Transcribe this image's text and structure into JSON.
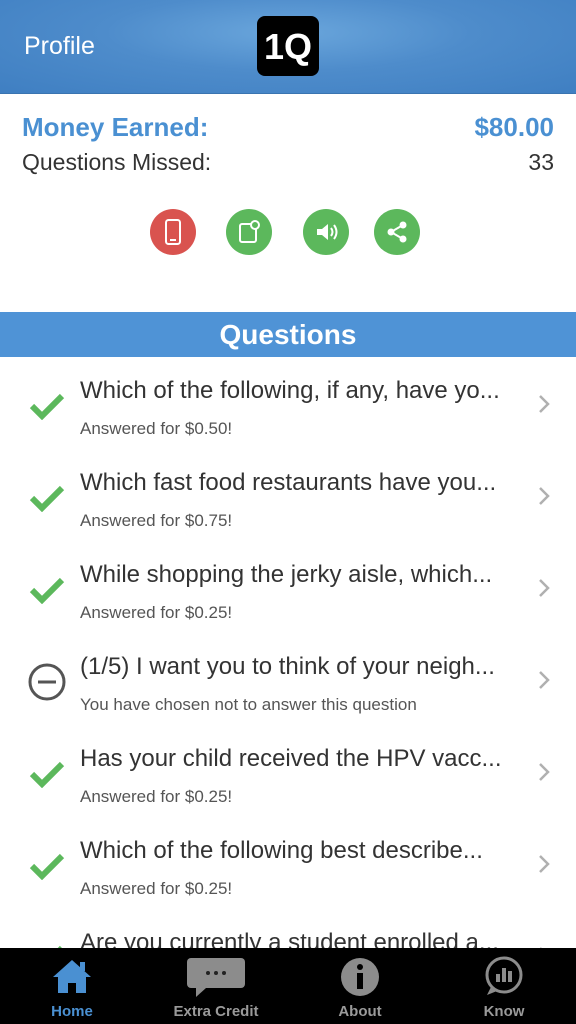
{
  "header": {
    "back_label": "Profile",
    "logo_text": "1Q"
  },
  "stats": {
    "money_label": "Money Earned:",
    "money_value": "$80.00",
    "missed_label": "Questions Missed:",
    "missed_value": "33"
  },
  "actions": [
    {
      "icon": "phone-icon",
      "color": "#d9534f"
    },
    {
      "icon": "tablet-notification-icon",
      "color": "#5cb85c"
    },
    {
      "icon": "speaker-icon",
      "color": "#5cb85c"
    },
    {
      "icon": "share-icon",
      "color": "#5cb85c"
    }
  ],
  "section": {
    "title": "Questions"
  },
  "questions": [
    {
      "title": "Which of the following, if any, have yo...",
      "subtitle": "Answered for $0.50!",
      "status": "answered"
    },
    {
      "title": "Which fast food restaurants have you...",
      "subtitle": "Answered for $0.75!",
      "status": "answered"
    },
    {
      "title": "While shopping the jerky aisle, which...",
      "subtitle": "Answered for $0.25!",
      "status": "answered"
    },
    {
      "title": "(1/5) I want you to think of your neigh...",
      "subtitle": "You have chosen not to answer this question",
      "status": "declined"
    },
    {
      "title": "Has your child received the HPV vacc...",
      "subtitle": "Answered for $0.25!",
      "status": "answered"
    },
    {
      "title": "Which of the following best describe...",
      "subtitle": "Answered for $0.25!",
      "status": "answered"
    },
    {
      "title": "Are you currently a student enrolled a...",
      "subtitle": "",
      "status": "answered"
    }
  ],
  "tabs": [
    {
      "label": "Home",
      "icon": "home-icon",
      "active": true
    },
    {
      "label": "Extra Credit",
      "icon": "chat-bubble-icon",
      "active": false
    },
    {
      "label": "About",
      "icon": "info-icon",
      "active": false
    },
    {
      "label": "Know",
      "icon": "chart-bubble-icon",
      "active": false
    }
  ],
  "colors": {
    "accent": "#4a90d2",
    "check": "#5cb85c",
    "danger": "#d9534f"
  }
}
